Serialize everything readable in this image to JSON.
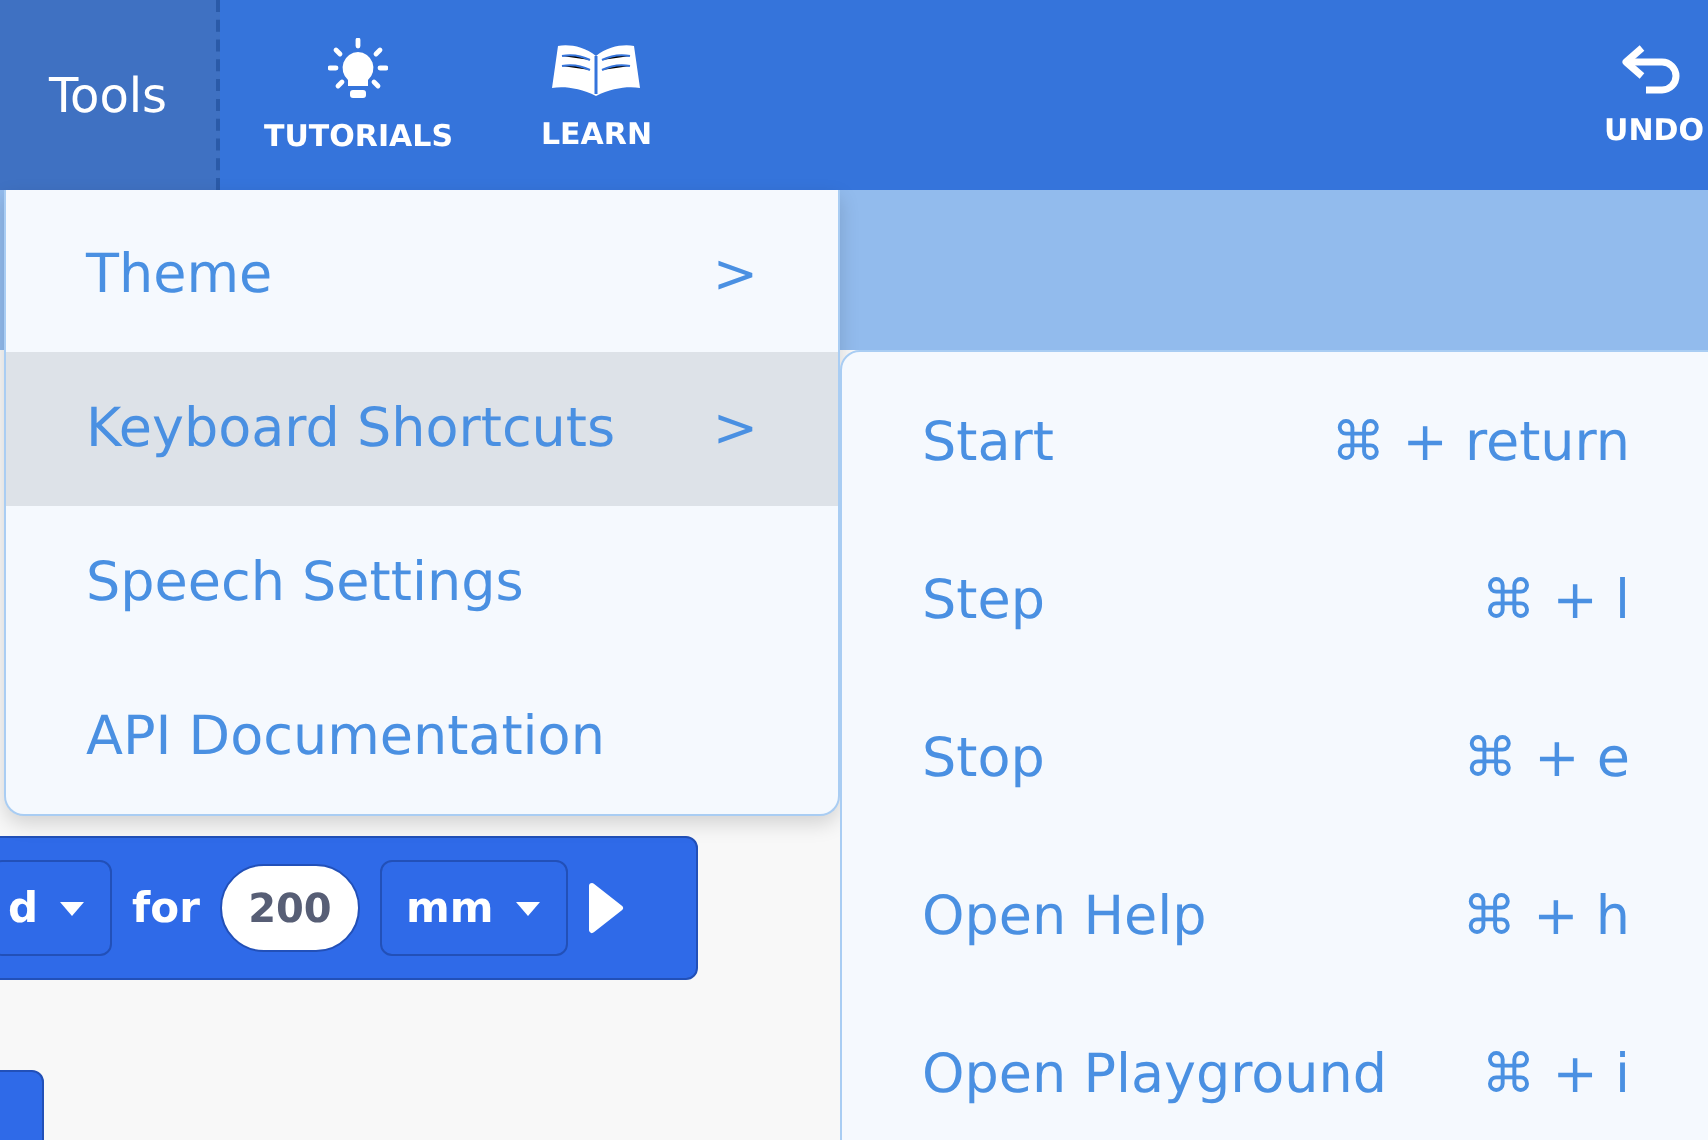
{
  "toolbar": {
    "tools_label": "Tools",
    "buttons": [
      {
        "kind": "bulb",
        "label": "TUTORIALS"
      },
      {
        "kind": "book",
        "label": "LEARN"
      }
    ],
    "undo": "UNDO"
  },
  "tools_menu": [
    {
      "label": "Theme",
      "arrow": ">",
      "selected": false
    },
    {
      "label": "Keyboard Shortcuts",
      "arrow": ">",
      "selected": true
    },
    {
      "label": "Speech Settings",
      "selected": false
    },
    {
      "label": "API Documentation",
      "selected": false
    }
  ],
  "shortcuts_menu": [
    {
      "label": "Start",
      "shortcut": "⌘ + return"
    },
    {
      "label": "Step",
      "shortcut": "⌘ + l"
    },
    {
      "label": "Stop",
      "shortcut": "⌘ + e"
    },
    {
      "label": "Open Help",
      "shortcut": "⌘ + h"
    },
    {
      "label": "Open Playground",
      "shortcut": "⌘ + i"
    }
  ],
  "block": {
    "dropdown": "d",
    "word": "for",
    "value": "200",
    "unit": "mm"
  }
}
